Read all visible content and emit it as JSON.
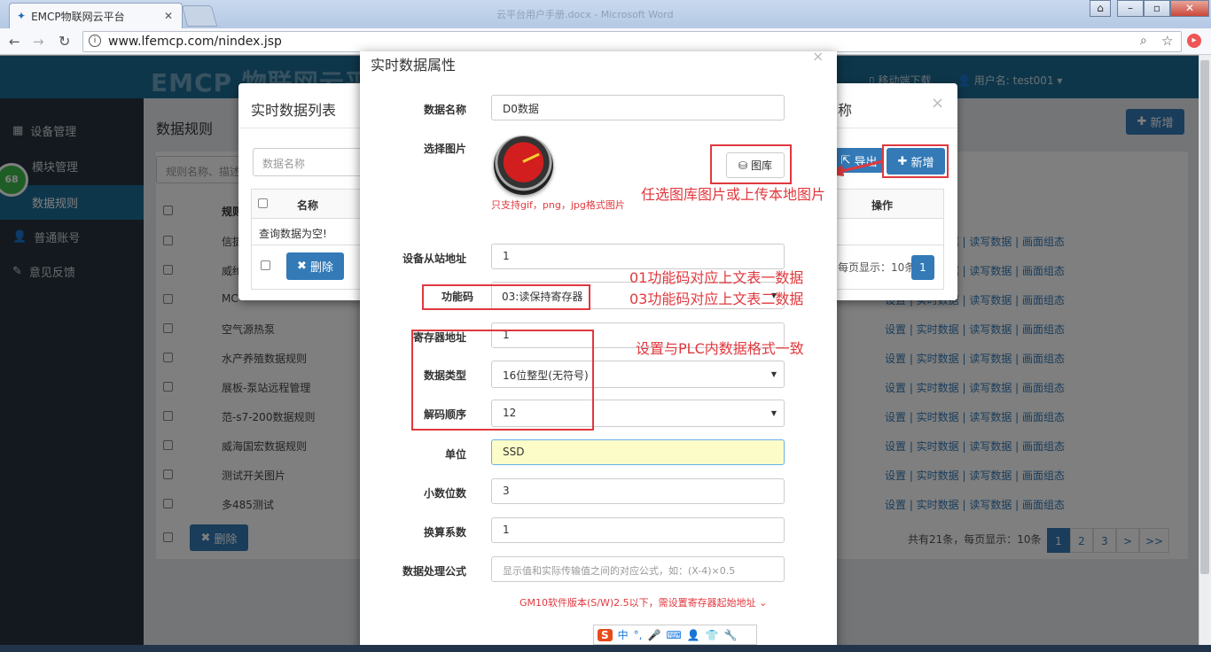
{
  "browser": {
    "tab_title": "EMCP物联网云平台",
    "url": "www.lfemcp.com/nindex.jsp",
    "window_title": "云平台用户手册.docx - Microsoft Word"
  },
  "app": {
    "logo": "EMCP 物联网云平台",
    "mobile_download": "移动端下载",
    "user": "用户名: test001"
  },
  "sidebar": {
    "items": [
      {
        "label": "设备管理"
      },
      {
        "label": "模块管理"
      },
      {
        "label": "数据规则"
      },
      {
        "label": "普通账号"
      },
      {
        "label": "意见反馈"
      }
    ],
    "badge": "68"
  },
  "rules_page": {
    "title": "数据规则",
    "search_placeholder": "规则名称、描述",
    "add_label": "新增",
    "col_rule": "规则",
    "col_ops": "操作",
    "rows": [
      {
        "name": "信捷",
        "ops": "设置 | 实时数据 | 读写数据 | 画面组态"
      },
      {
        "name": "威纶",
        "ops": "设置 | 实时数据 | 读写数据 | 画面组态"
      },
      {
        "name": "MC",
        "ops": "设置 | 实时数据 | 读写数据 | 画面组态"
      },
      {
        "name": "空气源热泵",
        "ops": "设置 | 实时数据 | 读写数据 | 画面组态"
      },
      {
        "name": "水产养殖数据规则",
        "ops": "设置 | 实时数据 | 读写数据 | 画面组态"
      },
      {
        "name": "展板-泵站远程管理",
        "ops": "设置 | 实时数据 | 读写数据 | 画面组态"
      },
      {
        "name": "范-s7-200数据规则",
        "ops": "设置 | 实时数据 | 读写数据 | 画面组态"
      },
      {
        "name": "威海国宏数据规则",
        "ops": "设置 | 实时数据 | 读写数据 | 画面组态"
      },
      {
        "name": "测试开关图片",
        "ops": "设置 | 实时数据 | 读写数据 | 画面组态"
      },
      {
        "name": "多485测试",
        "ops": "设置 | 实时数据 | 读写数据 | 画面组态"
      }
    ],
    "delete_label": "删除",
    "pager_info": "共有21条，每页显示：10条",
    "pages": [
      "1",
      "2",
      "3",
      ">",
      ">>"
    ]
  },
  "modal_list": {
    "title": "实时数据列表",
    "search_placeholder": "数据名称",
    "col_name": "名称",
    "col_ops": "操作",
    "empty": "查询数据为空!",
    "delete_label": "删除",
    "export_label": "导出",
    "add_label": "新增",
    "pager_info": "每页显示：10条",
    "page": "1",
    "title_suffix": "称"
  },
  "modal_attr": {
    "title": "实时数据属性",
    "fields": {
      "name_label": "数据名称",
      "name_value": "D0数据",
      "image_label": "选择图片",
      "gallery_button": "图库",
      "image_hint": "只支持gif，png，jpg格式图片",
      "slave_label": "设备从站地址",
      "slave_value": "1",
      "func_label": "功能码",
      "func_value": "03:读保持寄存器",
      "reg_label": "寄存器地址",
      "reg_value": "1",
      "type_label": "数据类型",
      "type_value": "16位整型(无符号)",
      "order_label": "解码顺序",
      "order_value": "12",
      "unit_label": "单位",
      "unit_value": "SSD",
      "decimal_label": "小数位数",
      "decimal_value": "3",
      "factor_label": "换算系数",
      "factor_value": "1",
      "formula_label": "数据处理公式",
      "formula_placeholder": "显示值和实际传输值之间的对应公式，如：(X-4)×0.5",
      "footnote": "GM10软件版本(S/W)2.5以下，需设置寄存器起始地址"
    }
  },
  "annotations": {
    "gallery_note": "任选图库图片或上传本地图片",
    "func01": "01功能码对应上文表一数据",
    "func03": "03功能码对应上文表二数据",
    "plc": "设置与PLC内数据格式一致"
  },
  "ime": {
    "lang": "中"
  },
  "colors": {
    "header": "#1d6c94",
    "sidebar": "#27333d",
    "primary": "#337ab7",
    "annotation": "#e0383e",
    "unit_bg": "#fcfcc8"
  }
}
